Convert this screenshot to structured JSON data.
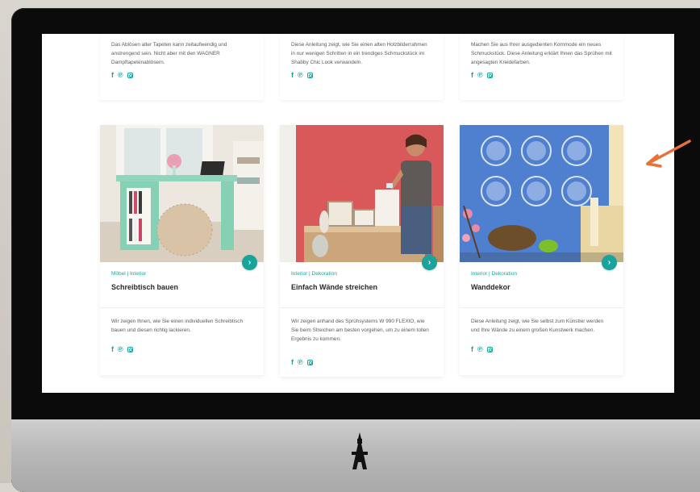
{
  "top_row": [
    {
      "description": "Das Ablösen alter Tapeten kann zeitaufwendig und anstrengend sein. Nicht aber mit den WAGNER Dampftapetenablösern."
    },
    {
      "description": "Diese Anleitung zeigt, wie Sie einen alten Holzbilderrahmen in nur wenigen Schritten in ein trendiges Schmuckstück im Shabby Chic Look verwandeln."
    },
    {
      "description": "Machen Sie aus Ihrer ausgedienten Kommode ein neues Schmuckstück. Diese Anleitung erklärt Ihnen das Sprühen mit angesagten Kreidefarben."
    }
  ],
  "cards": [
    {
      "category": "Möbel | Interior",
      "title": "Schreibtisch bauen",
      "description": "Wir zeigen Ihnen, wie Sie einen individuellen Schreibtisch bauen und diesen richtig lackieren.",
      "image": "mint-green-desk-photo"
    },
    {
      "category": "Interior | Dekoration",
      "title": "Einfach Wände streichen",
      "description": "Wir zeigen anhand des Sprühsystems W 990 FLEXIO, wie Sie beim Streichen am besten vorgehen, um zu einem tollen Ergebnis zu kommen.",
      "image": "woman-red-wall-photo"
    },
    {
      "category": "Interior | Dekoration",
      "title": "Wanddekor",
      "description": "Diese Anleitung zeigt, wie Sie selbst zum Künstler werden und Ihre Wände zu einem großen Kunstwerk machen.",
      "image": "blue-wall-stencil-photo"
    }
  ],
  "social_icons": [
    "facebook-icon",
    "pinterest-icon",
    "instagram-icon"
  ],
  "colors": {
    "accent": "#1aa39a",
    "arrow": "#e8713a",
    "bezel": "#0b0b0b"
  }
}
